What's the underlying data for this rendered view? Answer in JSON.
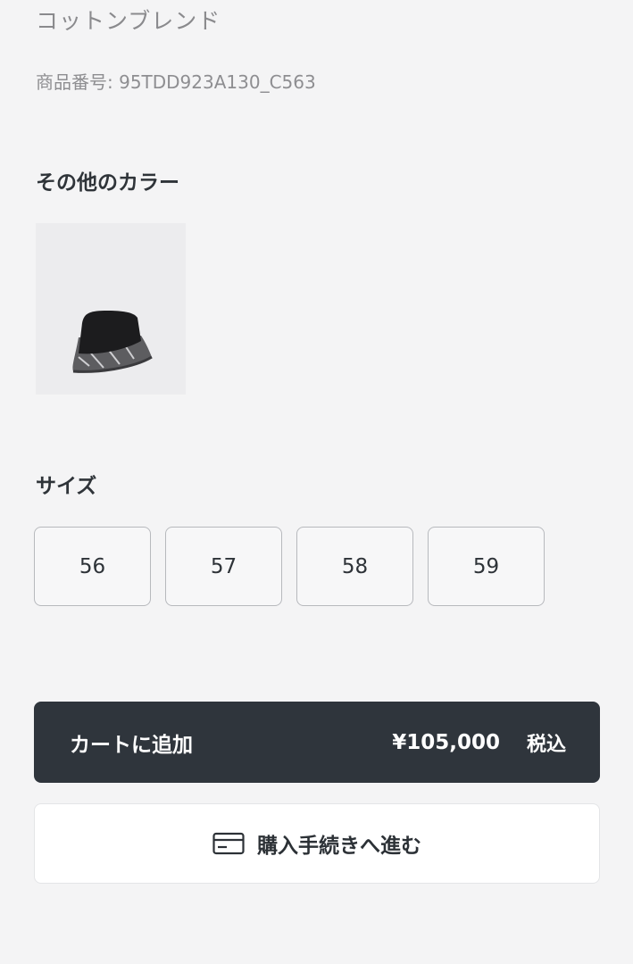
{
  "product": {
    "material": "コットンブレンド",
    "sku": "商品番号: 95TDD923A130_C563"
  },
  "colors": {
    "title": "その他のカラー",
    "swatches": [
      {
        "icon": "bucket-hat-thumbnail",
        "hat_color": "#1c1c1e",
        "band_color": "#5d5d60"
      }
    ]
  },
  "sizes": {
    "title": "サイズ",
    "options": [
      "56",
      "57",
      "58",
      "59"
    ]
  },
  "cart": {
    "label": "カートに追加",
    "price": "¥105,000",
    "tax": "税込",
    "bg_color": "#2f353c"
  },
  "checkout": {
    "icon": "credit-card-icon",
    "label": "購入手続きへ進む"
  }
}
